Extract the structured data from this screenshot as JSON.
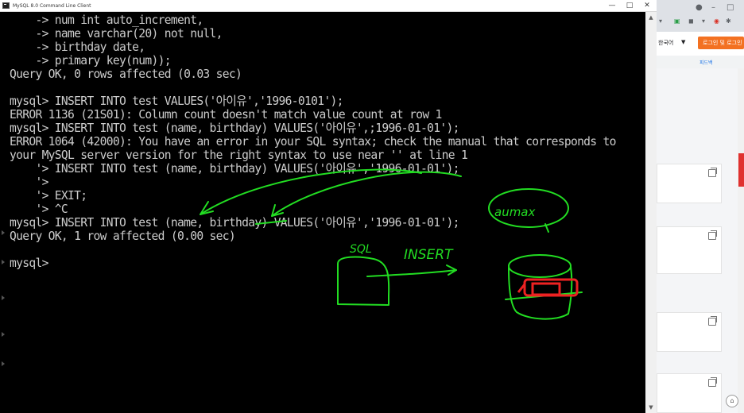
{
  "window": {
    "title": "MySQL 8.0 Command Line Client",
    "minimize_glyph": "—",
    "maximize_glyph": "□",
    "close_glyph": "✕",
    "icon": "console-icon"
  },
  "terminal": {
    "lines": [
      "    -> num int auto_increment,",
      "    -> name varchar(20) not null,",
      "    -> birthday date,",
      "    -> primary key(num));",
      "Query OK, 0 rows affected (0.03 sec)",
      "",
      "mysql> INSERT INTO test VALUES('아이유','1996-0101');",
      "ERROR 1136 (21S01): Column count doesn't match value count at row 1",
      "mysql> INSERT INTO test (name, birthday) VALUES('아이유',;1996-01-01');",
      "ERROR 1064 (42000): You have an error in your SQL syntax; check the manual that corresponds to",
      "your MySQL server version for the right syntax to use near '' at line 1",
      "    '> INSERT INTO test (name, birthday) VALUES('아이유','1996-01-01');",
      "    '>",
      "    '> EXIT;",
      "    '> ^C",
      "mysql> INSERT INTO test (name, birthday) VALUES('아이유','1996-01-01');",
      "Query OK, 1 row affected (0.00 sec)",
      "",
      "mysql>"
    ]
  },
  "annotations": {
    "color": "#22dd22",
    "marker_color": "#ee2222",
    "labels": {
      "auto_max": "aumax",
      "sql": "SQL",
      "insert": "INSERT"
    }
  },
  "browser": {
    "language_label": "한국어",
    "language_caret": "▼",
    "login_label": "로그인 및 로그인",
    "feedback_label": "피드백",
    "accent": "#f37121"
  },
  "colors": {
    "console_bg": "#000000",
    "console_text": "#cccccc"
  }
}
